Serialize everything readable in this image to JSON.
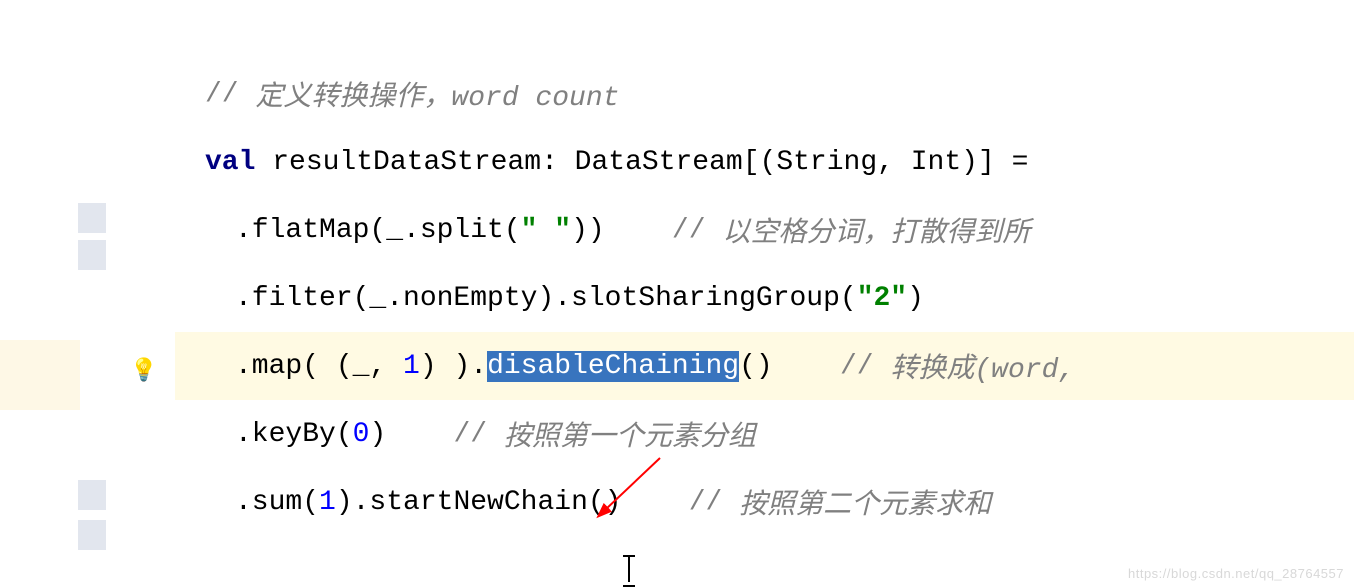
{
  "editor": {
    "line1": {
      "slashes": "// ",
      "comment": "定义转换操作，word count"
    },
    "line2": {
      "kw1": "val",
      "p1": " resultDataStream: DataStream[(",
      "kw2": "String",
      "p2": ", ",
      "kw3": "Int",
      "p3": ")] = "
    },
    "line3": {
      "p1": ".flatMap(_.split(",
      "str": "\" \"",
      "p2": "))    ",
      "slashes": "// ",
      "comment": "以空格分词，打散得到所"
    },
    "line4": {
      "p1": ".filter(_.nonEmpty).slotSharingGroup(",
      "str": "\"2\"",
      "p2": ")"
    },
    "line5": {
      "p1": ".map( (_, ",
      "num": "1",
      "p2": ") ).",
      "sel": "disableChaining",
      "p3": "()    ",
      "slashes": "// ",
      "comment": "转换成(word,"
    },
    "line6": {
      "p1": ".keyBy(",
      "num": "0",
      "p2": ")    ",
      "slashes": "// ",
      "comment": "按照第一个元素分组"
    },
    "line7": {
      "p1": ".sum(",
      "num": "1",
      "p2": ").startNewChain()    ",
      "slashes": "// ",
      "comment": "按照第二个元素求和"
    }
  },
  "bulb": "💡",
  "watermark": "https://blog.csdn.net/qq_28764557"
}
